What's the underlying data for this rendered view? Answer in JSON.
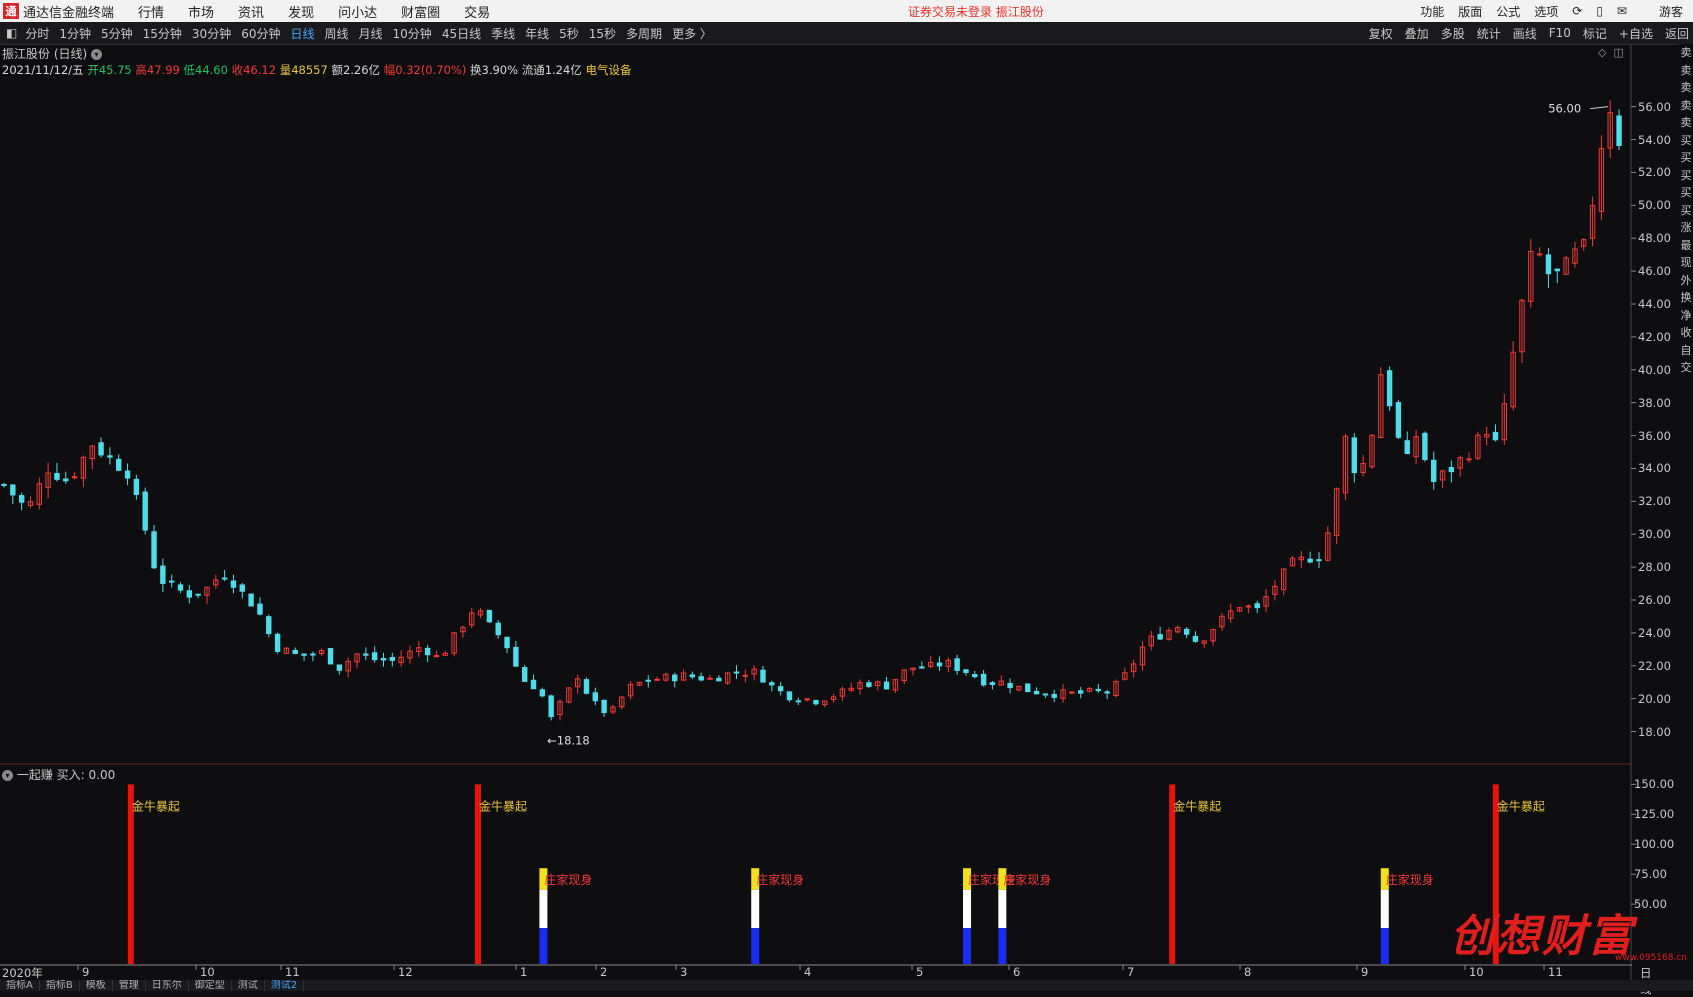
{
  "menubar": {
    "app_title": "通达信金融终端",
    "items": [
      "行情",
      "市场",
      "资讯",
      "发现",
      "问小达",
      "财富圈",
      "交易"
    ],
    "login_status": "证券交易未登录   振江股份",
    "right_items": [
      "功能",
      "版面",
      "公式",
      "选项"
    ],
    "guest": "游客"
  },
  "periods": [
    "分时",
    "1分钟",
    "5分钟",
    "15分钟",
    "30分钟",
    "60分钟",
    "日线",
    "周线",
    "月线",
    "10分钟",
    "45日线",
    "季线",
    "年线",
    "5秒",
    "15秒",
    "多周期",
    "更多 〉"
  ],
  "active_period": "日线",
  "tools": [
    "复权",
    "叠加",
    "多股",
    "统计",
    "画线",
    "F10",
    "标记",
    "+自选",
    "返回"
  ],
  "stock": {
    "name_line": "振江股份 (日线)",
    "date": "2021/11/12/五",
    "open": "开45.75",
    "high": "高47.99",
    "low": "低44.60",
    "close": "收46.12",
    "volume": "量48557",
    "amount": "额2.26亿",
    "change": "幅0.32(0.70%)",
    "turnover": "换3.90%",
    "float": "流通1.24亿",
    "sector": "电气设备"
  },
  "indicator": {
    "header": "一起赚  买入: 0.00"
  },
  "x_axis_labels": [
    "2020年",
    "9",
    "10",
    "11",
    "12",
    "1",
    "2",
    "3",
    "4",
    "5",
    "6",
    "7",
    "8",
    "9",
    "10",
    "11",
    "日线"
  ],
  "bottom_tabs": [
    "指标A",
    "指标B",
    "模板",
    "管理",
    "日东尔",
    "御定型",
    "测试",
    "测试2"
  ],
  "right_strip": [
    "卖",
    "卖",
    "卖",
    "卖",
    "卖",
    "买",
    "买",
    "买",
    "买",
    "买",
    "涨",
    "最",
    "现",
    "外",
    "换",
    "净",
    "收",
    "自",
    "交"
  ],
  "watermark": "创想财富",
  "watermark_url": "www.095168.cn",
  "colors": {
    "up": "#f03a3a",
    "down": "#4fdce8",
    "bull_bar": "#e8140c",
    "label_yellow": "#e8c440",
    "label_red": "#f03a3a"
  },
  "chart_data": [
    {
      "type": "candlestick",
      "title": "振江股份 (日线)",
      "ylim": [
        17,
        57.5
      ],
      "y_ticks": [
        18,
        20,
        22,
        24,
        26,
        28,
        30,
        32,
        34,
        36,
        38,
        40,
        42,
        44,
        46,
        48,
        50,
        52,
        54,
        56
      ],
      "annotations": [
        {
          "text": "56.00",
          "kind": "high"
        },
        {
          "text": "←18.18",
          "kind": "low"
        }
      ],
      "close_path": [
        [
          0,
          33
        ],
        [
          8,
          31.5
        ],
        [
          15,
          34
        ],
        [
          22,
          33.2
        ],
        [
          30,
          35.5
        ],
        [
          36,
          34.6
        ],
        [
          42,
          33.8
        ],
        [
          48,
          30.3
        ],
        [
          52,
          27.4
        ],
        [
          58,
          26.7
        ],
        [
          64,
          26.3
        ],
        [
          70,
          26.8
        ],
        [
          74,
          27.7
        ],
        [
          78,
          27.1
        ],
        [
          82,
          26.2
        ],
        [
          86,
          25.5
        ],
        [
          92,
          23.2
        ],
        [
          100,
          22.6
        ],
        [
          108,
          22.8
        ],
        [
          114,
          21.9
        ],
        [
          120,
          22.7
        ],
        [
          126,
          22.4
        ],
        [
          132,
          22.3
        ],
        [
          138,
          22.8
        ],
        [
          142,
          23.2
        ],
        [
          148,
          22.4
        ],
        [
          154,
          24.0
        ],
        [
          160,
          25.6
        ],
        [
          166,
          24.2
        ],
        [
          170,
          23.6
        ],
        [
          176,
          21.2
        ],
        [
          182,
          20.6
        ],
        [
          186,
          18.8
        ],
        [
          190,
          19.9
        ],
        [
          195,
          21.4
        ],
        [
          200,
          19.8
        ],
        [
          206,
          19.0
        ],
        [
          212,
          20.6
        ],
        [
          218,
          21.1
        ],
        [
          226,
          21.3
        ],
        [
          232,
          21.4
        ],
        [
          240,
          21.2
        ],
        [
          248,
          21.6
        ],
        [
          256,
          21.6
        ],
        [
          262,
          20.6
        ],
        [
          268,
          20.1
        ],
        [
          276,
          19.9
        ],
        [
          284,
          20.3
        ],
        [
          292,
          21.0
        ],
        [
          300,
          20.8
        ],
        [
          308,
          21.9
        ],
        [
          314,
          21.9
        ],
        [
          320,
          22.2
        ],
        [
          328,
          21.6
        ],
        [
          334,
          21.0
        ],
        [
          340,
          21.0
        ],
        [
          346,
          20.6
        ],
        [
          352,
          20.4
        ],
        [
          358,
          20.3
        ],
        [
          364,
          20.3
        ],
        [
          370,
          20.4
        ],
        [
          376,
          20.4
        ],
        [
          382,
          21.6
        ],
        [
          388,
          23.4
        ],
        [
          394,
          24.0
        ],
        [
          400,
          24.5
        ],
        [
          406,
          23.4
        ],
        [
          412,
          24.5
        ],
        [
          420,
          25.7
        ],
        [
          426,
          25.4
        ],
        [
          432,
          26.9
        ],
        [
          438,
          28.2
        ],
        [
          444,
          28.6
        ],
        [
          448,
          28.7
        ],
        [
          452,
          31.5
        ],
        [
          456,
          35.8
        ],
        [
          460,
          33.5
        ],
        [
          464,
          35.0
        ],
        [
          468,
          39.8
        ],
        [
          472,
          37.5
        ],
        [
          476,
          34.0
        ],
        [
          480,
          36.0
        ],
        [
          486,
          33.2
        ],
        [
          492,
          34.0
        ],
        [
          498,
          35.0
        ],
        [
          504,
          36.4
        ],
        [
          508,
          35.2
        ],
        [
          512,
          40.0
        ],
        [
          516,
          44.0
        ],
        [
          520,
          47.6
        ],
        [
          526,
          45.5
        ],
        [
          530,
          46.0
        ],
        [
          534,
          47.0
        ],
        [
          538,
          47.5
        ],
        [
          542,
          53.0
        ],
        [
          546,
          56.0
        ],
        [
          548,
          54.0
        ],
        [
          550,
          54.0
        ]
      ],
      "note": "daily candles from 2020-08 to 2021-11; x = trading-day index, y = close price"
    },
    {
      "type": "bar",
      "title": "一起赚",
      "ylim": [
        0,
        162
      ],
      "y_ticks": [
        50,
        75,
        100,
        125,
        150
      ],
      "series": [
        {
          "name": "金牛暴起",
          "x": [
            20,
            138,
            374,
            484
          ],
          "values": [
            150,
            150,
            150,
            150
          ]
        },
        {
          "name": "庄家现身",
          "x": [
            182,
            254,
            326,
            338,
            468
          ],
          "values": [
            80,
            80,
            80,
            80,
            80
          ]
        }
      ]
    }
  ]
}
